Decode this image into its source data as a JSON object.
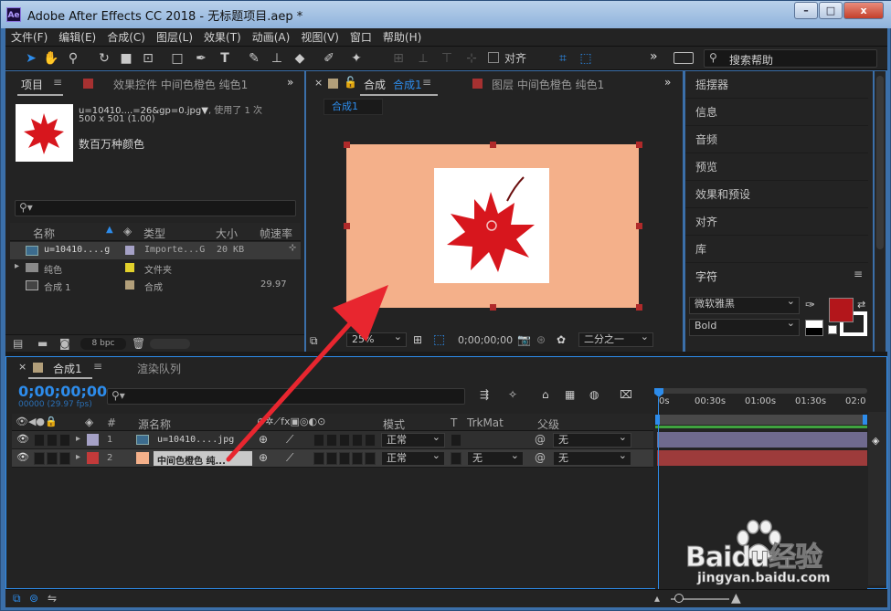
{
  "window": {
    "title": "Adobe After Effects CC 2018 - 无标题项目.aep *",
    "app_icon": "Ae",
    "min": "–",
    "max": "□",
    "close": "x"
  },
  "menu": [
    "文件(F)",
    "编辑(E)",
    "合成(C)",
    "图层(L)",
    "效果(T)",
    "动画(A)",
    "视图(V)",
    "窗口",
    "帮助(H)"
  ],
  "toolbar": {
    "align_label": "对齐",
    "search_placeholder": "搜索帮助",
    "overflow": "»"
  },
  "project": {
    "tab_project": "项目",
    "tab_effects": "效果控件 中间色橙色 纯色1",
    "file_name": "u=10410....=26&gp=0.jpg▼",
    "used_label": ", 使用了 1 次",
    "dims": "500 x 501 (1.00)",
    "colors": "数百万种颜色",
    "col_name": "名称",
    "col_type": "类型",
    "col_size": "大小",
    "col_fps": "帧速率",
    "rows": [
      {
        "name": "u=10410....g",
        "type": "Importe...G",
        "size": "20 KB",
        "fps": "",
        "color": "#a5a1c6"
      },
      {
        "name": "纯色",
        "type": "文件夹",
        "size": "",
        "fps": "",
        "color": "#e2d12c"
      },
      {
        "name": "合成 1",
        "type": "合成",
        "size": "",
        "fps": "29.97",
        "color": "#b29f7a"
      }
    ],
    "bpc": "8 bpc"
  },
  "composition": {
    "tab_label": "合成",
    "tab_name": "合成1",
    "crumb": "合成1",
    "layer_tab": "图层 中间色橙色 纯色1",
    "zoom": "25%",
    "time": "0;00;00;00",
    "resolution": "二分之一",
    "bg_color": "#f4b08a"
  },
  "right_panels": [
    "摇摆器",
    "信息",
    "音频",
    "预览",
    "效果和预设",
    "对齐",
    "库"
  ],
  "character": {
    "title": "字符",
    "font": "微软雅黑",
    "style": "Bold",
    "fill_color": "#b3161b",
    "stroke_color": "#ffffff"
  },
  "timeline": {
    "tab_comp": "合成1",
    "tab_render": "渲染队列",
    "timecode": "0;00;00;00",
    "timecode_sub": "00000 (29.97 fps)",
    "col_source": "源名称",
    "col_mode": "模式",
    "col_t": "T",
    "col_trkmat": "TrkMat",
    "col_parent": "父级",
    "ruler": [
      "0s",
      "00:30s",
      "01:00s",
      "01:30s",
      "02:0"
    ],
    "layers": [
      {
        "num": "1",
        "name": "u=10410....jpg",
        "mode": "正常",
        "trkmat": "",
        "parent": "无",
        "color": "#a5a1c6",
        "bar": "#6f6a8e"
      },
      {
        "num": "2",
        "name": "中间色橙色 纯...",
        "mode": "正常",
        "trkmat": "无",
        "parent": "无",
        "color": "#c23a3a",
        "bar": "#9d3b3b"
      }
    ]
  },
  "watermark": {
    "brand": "Baidu经验",
    "url": "jingyan.baidu.com"
  }
}
